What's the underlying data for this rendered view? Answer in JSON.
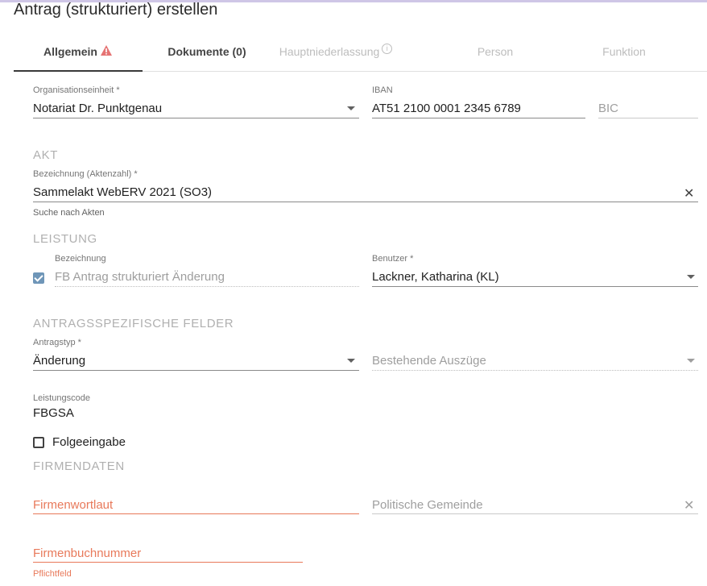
{
  "page": {
    "title": "Antrag (strukturiert) erstellen"
  },
  "tabs": [
    {
      "label": "Allgemein",
      "icon": "warning-icon",
      "state": "active"
    },
    {
      "label": "Dokumente (0)",
      "state": "enabled"
    },
    {
      "label": "Hauptniederlassung",
      "icon": "info-icon",
      "state": "disabled"
    },
    {
      "label": "Person",
      "state": "disabled"
    },
    {
      "label": "Funktion",
      "state": "disabled"
    }
  ],
  "general": {
    "org_unit": {
      "label": "Organisationseinheit *",
      "value": "Notariat Dr. Punktgenau"
    },
    "iban": {
      "label": "IBAN",
      "value": "AT51 2100 0001 2345 6789"
    },
    "bic": {
      "placeholder": "BIC"
    }
  },
  "akt": {
    "section": "AKT",
    "designation": {
      "label": "Bezeichnung (Aktenzahl) *",
      "value": "Sammelakt WebERV 2021 (SO3)",
      "hint": "Suche nach Akten"
    }
  },
  "leistung": {
    "section": "LEISTUNG",
    "designation": {
      "label": "Bezeichnung",
      "value": "FB Antrag strukturiert Änderung",
      "checked": true
    },
    "user": {
      "label": "Benutzer *",
      "value": "Lackner, Katharina (KL)"
    }
  },
  "antrag": {
    "section": "ANTRAGSSPEZIFISCHE FELDER",
    "type": {
      "label": "Antragstyp *",
      "value": "Änderung"
    },
    "excerpts": {
      "placeholder": "Bestehende Auszüge"
    },
    "code": {
      "label": "Leistungscode",
      "value": "FBGSA"
    },
    "followup": {
      "label": "Folgeeingabe",
      "checked": false
    }
  },
  "firma": {
    "section": "FIRMENDATEN",
    "wording": {
      "placeholder": "Firmenwortlaut"
    },
    "municipality": {
      "placeholder": "Politische Gemeinde"
    },
    "register_number": {
      "placeholder": "Firmenbuchnummer",
      "error": "Pflichtfeld"
    }
  },
  "colors": {
    "accent_error": "#e8795a",
    "checkbox": "#6f96b8",
    "warning": "#e57373"
  }
}
